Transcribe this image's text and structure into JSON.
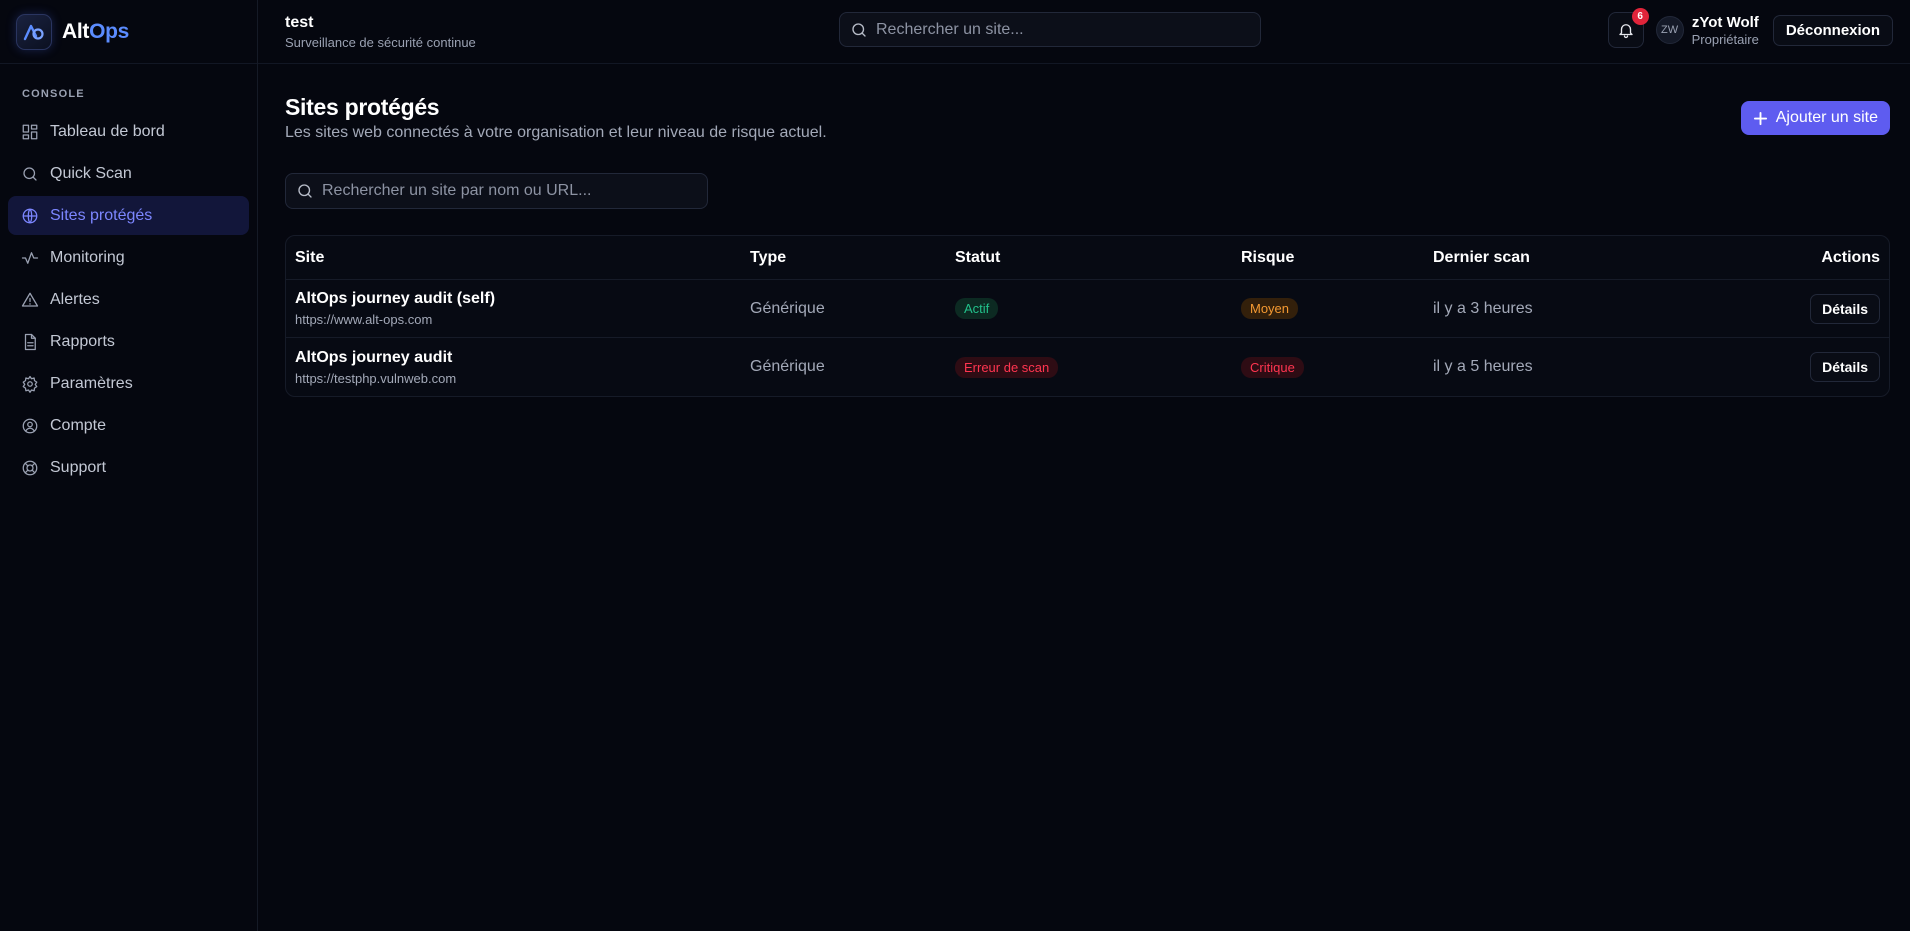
{
  "app": {
    "name_prefix": "Alt",
    "name_suffix": "Ops",
    "accent_color": "#5e5cf0"
  },
  "sidebar": {
    "section_label": "CONSOLE",
    "items": [
      {
        "label": "Tableau de bord",
        "icon": "dashboard-icon",
        "active": false
      },
      {
        "label": "Quick Scan",
        "icon": "search-icon",
        "active": false
      },
      {
        "label": "Sites protégés",
        "icon": "globe-icon",
        "active": true
      },
      {
        "label": "Monitoring",
        "icon": "activity-icon",
        "active": false
      },
      {
        "label": "Alertes",
        "icon": "warning-icon",
        "active": false
      },
      {
        "label": "Rapports",
        "icon": "file-icon",
        "active": false
      },
      {
        "label": "Paramètres",
        "icon": "gear-icon",
        "active": false
      },
      {
        "label": "Compte",
        "icon": "user-circle-icon",
        "active": false
      },
      {
        "label": "Support",
        "icon": "lifebuoy-icon",
        "active": false
      }
    ]
  },
  "header": {
    "org_name": "test",
    "org_subtitle": "Surveillance de sécurité continue",
    "search_placeholder": "Rechercher un site...",
    "notifications_count": "6",
    "avatar_initials": "ZW",
    "user_name": "zYot Wolf",
    "user_role": "Propriétaire",
    "logout_label": "Déconnexion"
  },
  "page": {
    "title": "Sites protégés",
    "subtitle": "Les sites web connectés à votre organisation et leur niveau de risque actuel.",
    "add_button_label": "Ajouter un site",
    "search_placeholder": "Rechercher un site par nom ou URL..."
  },
  "table": {
    "columns": [
      "Site",
      "Type",
      "Statut",
      "Risque",
      "Dernier scan",
      "Actions"
    ],
    "rows": [
      {
        "site_name": "AltOps journey audit (self)",
        "site_url": "https://www.alt-ops.com",
        "type": "Générique",
        "status": "Actif",
        "status_tone": "green",
        "risk": "Moyen",
        "risk_tone": "orange",
        "last_scan": "il y a 3 heures",
        "action_label": "Détails"
      },
      {
        "site_name": "AltOps journey audit",
        "site_url": "https://testphp.vulnweb.com",
        "type": "Générique",
        "status": "Erreur de scan",
        "status_tone": "red",
        "risk": "Critique",
        "risk_tone": "red",
        "last_scan": "il y a 5 heures",
        "action_label": "Détails"
      }
    ]
  }
}
